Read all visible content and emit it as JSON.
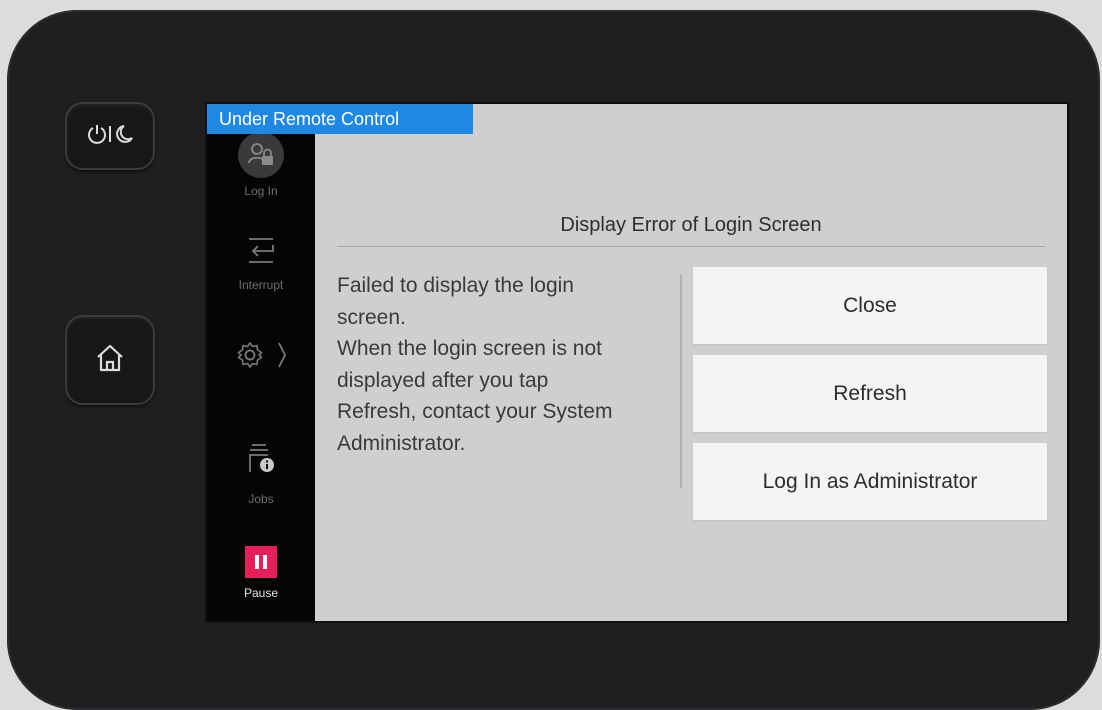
{
  "banner": {
    "text": "Under Remote Control",
    "color": "#1f88e5"
  },
  "sidebar": {
    "items": [
      {
        "label": "Log In",
        "icon": "login-lock-icon"
      },
      {
        "label": "Interrupt",
        "icon": "interrupt-icon"
      },
      {
        "label": "",
        "icon": "gear-icon"
      },
      {
        "label": "Jobs",
        "icon": "jobs-info-icon"
      },
      {
        "label": "Pause",
        "icon": "pause-icon",
        "color": "#e61e5a"
      }
    ]
  },
  "hardware": {
    "power_icon": "power-sleep-icon",
    "home_icon": "home-icon"
  },
  "dialog": {
    "title": "Display Error of Login Screen",
    "message_lines": [
      "Failed to display the login",
      "screen.",
      "When the login screen is not",
      "displayed after you tap",
      "Refresh, contact your System",
      "Administrator."
    ],
    "buttons": {
      "close": "Close",
      "refresh": "Refresh",
      "admin": "Log In as Administrator"
    }
  }
}
